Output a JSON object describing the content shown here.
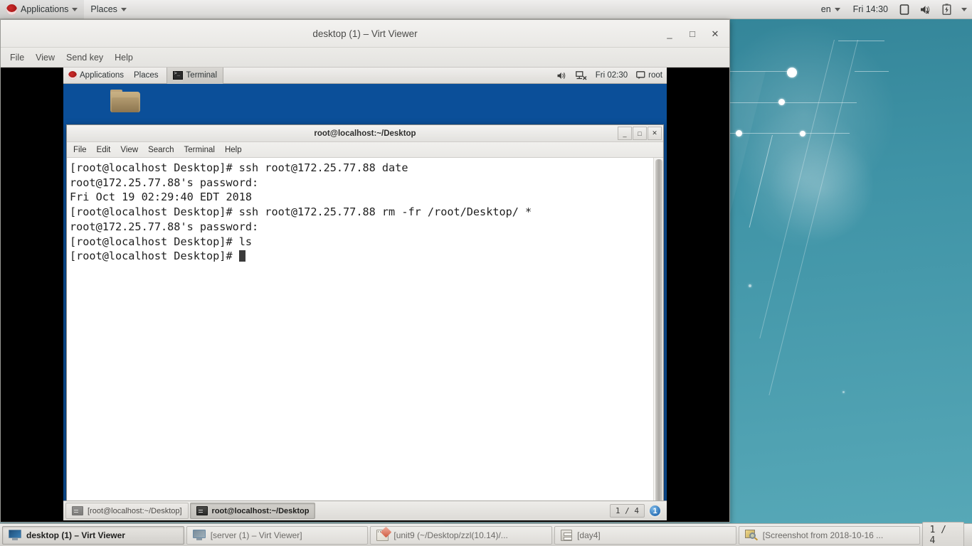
{
  "host_panel": {
    "applications_label": "Applications",
    "places_label": "Places",
    "language_label": "en",
    "clock": "Fri 14:30",
    "tray_icons": [
      "display-icon",
      "volume-muted-icon",
      "battery-charging-icon",
      "chevron-down-icon"
    ]
  },
  "virt_viewer": {
    "title": "desktop (1) – Virt Viewer",
    "window_buttons": {
      "minimize": "_",
      "maximize": "□",
      "close": "✕"
    },
    "menus": [
      "File",
      "View",
      "Send key",
      "Help"
    ]
  },
  "guest": {
    "panel": {
      "applications_label": "Applications",
      "places_label": "Places",
      "active_window_label": "Terminal",
      "clock": "Fri 02:30",
      "user_label": "root",
      "tray_icons": [
        "volume-icon",
        "network-disconnected-icon",
        "chat-icon"
      ]
    },
    "desktop_icons": [
      {
        "name": "folder-icon",
        "label": ""
      }
    ],
    "terminal": {
      "title": "root@localhost:~/Desktop",
      "menus": [
        "File",
        "Edit",
        "View",
        "Search",
        "Terminal",
        "Help"
      ],
      "window_buttons": {
        "minimize": "_",
        "maximize": "□",
        "close": "✕"
      },
      "lines": [
        "[root@localhost Desktop]# ssh root@172.25.77.88 date",
        "root@172.25.77.88's password:",
        "Fri Oct 19 02:29:40 EDT 2018",
        "[root@localhost Desktop]# ssh root@172.25.77.88 rm -fr /root/Desktop/ *",
        "root@172.25.77.88's password:",
        "[root@localhost Desktop]# ls",
        "[root@localhost Desktop]# "
      ]
    },
    "taskbar": {
      "tasks": [
        {
          "label": "[root@localhost:~/Desktop]",
          "active": false
        },
        {
          "label": "root@localhost:~/Desktop",
          "active": true
        }
      ],
      "workspace_indicator": "1 / 4",
      "notification_count": "1"
    }
  },
  "host_taskbar": {
    "tasks": [
      {
        "label": "desktop (1) – Virt Viewer",
        "icon": "monitor-icon",
        "active": true
      },
      {
        "label": "[server (1) – Virt Viewer]",
        "icon": "monitor-icon",
        "active": false
      },
      {
        "label": "[unit9 (~/Desktop/zzl(10.14)/...",
        "icon": "notepad-icon",
        "active": false
      },
      {
        "label": "[day4]",
        "icon": "archive-icon",
        "active": false
      },
      {
        "label": "[Screenshot from 2018-10-16 ...",
        "icon": "screenshot-icon",
        "active": false
      }
    ],
    "workspace_indicator": "1 / 4"
  },
  "colors": {
    "guest_desktop_blue": "#0b4f99",
    "wallpaper_teal": "#3f93a6",
    "panel_grey": "#e3e2e0",
    "terminal_bg": "#ffffff",
    "terminal_fg": "#1f1f1f"
  }
}
